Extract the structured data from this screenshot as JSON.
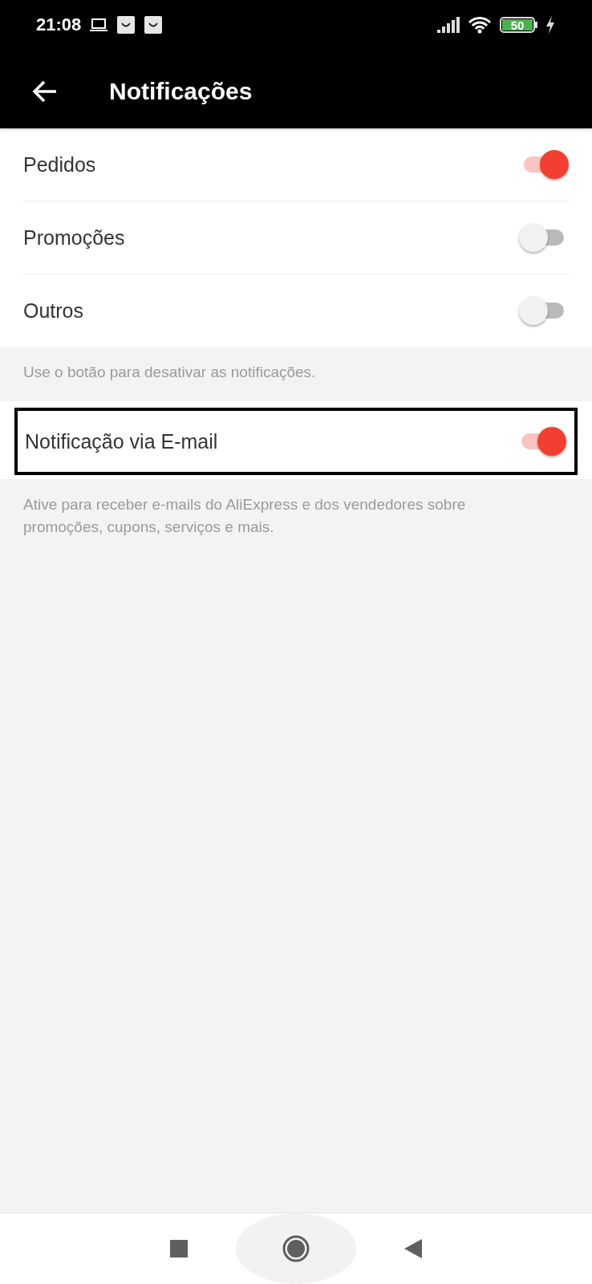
{
  "status_bar": {
    "time": "21:08",
    "battery": "50"
  },
  "header": {
    "title": "Notificações"
  },
  "sections": [
    {
      "highlighted": false,
      "items": [
        {
          "label": "Pedidos",
          "on": true
        },
        {
          "label": "Promoções",
          "on": false
        },
        {
          "label": "Outros",
          "on": false
        }
      ],
      "note": "Use o botão para desativar as notificações."
    },
    {
      "highlighted": true,
      "items": [
        {
          "label": "Notificação via E-mail",
          "on": true
        }
      ],
      "note": "Ative para receber e-mails do AliExpress e dos vendedores sobre promoções, cupons, serviços e mais."
    }
  ]
}
